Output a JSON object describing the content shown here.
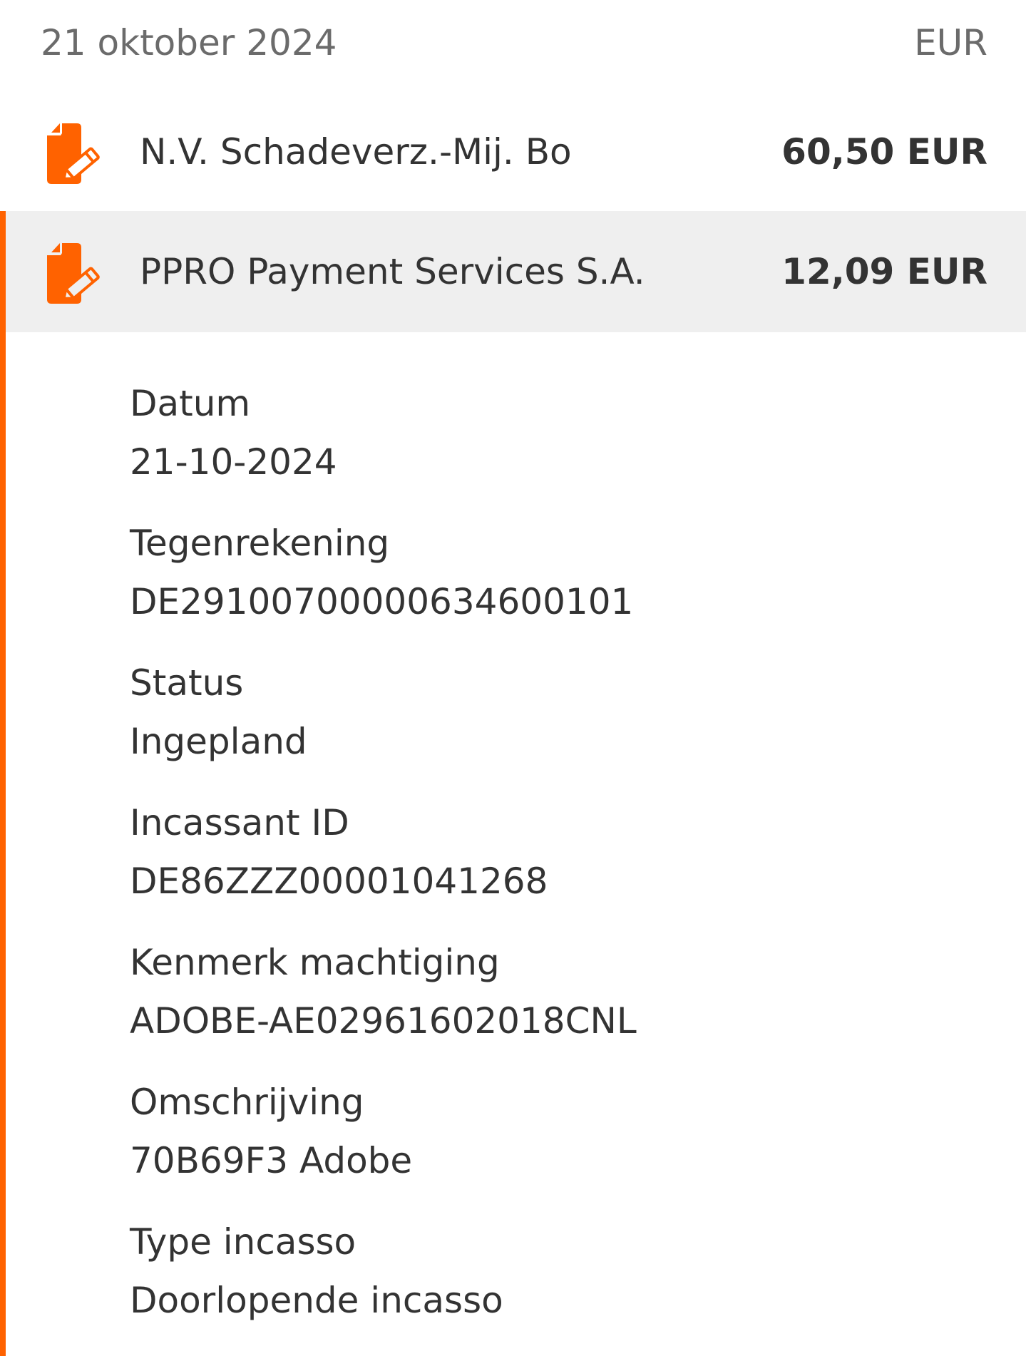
{
  "header": {
    "date": "21 oktober 2024",
    "currency": "EUR"
  },
  "colors": {
    "accent": "#ff6200",
    "selected_row_bg": "#efefef",
    "text": "#333333",
    "muted_text": "#6b6b6b"
  },
  "transactions": [
    {
      "icon": "direct-debit-icon",
      "name": "N.V. Schadeverz.-Mij. Bo",
      "amount": "60,50 EUR"
    },
    {
      "icon": "direct-debit-icon",
      "name": "PPRO Payment Services S.A.",
      "amount": "12,09 EUR"
    }
  ],
  "details": [
    {
      "label": "Datum",
      "value": "21-10-2024"
    },
    {
      "label": "Tegenrekening",
      "value": "DE29100700000634600101"
    },
    {
      "label": "Status",
      "value": "Ingepland"
    },
    {
      "label": "Incassant ID",
      "value": "DE86ZZZ00001041268"
    },
    {
      "label": "Kenmerk machtiging",
      "value": "ADOBE-AE02961602018CNL"
    },
    {
      "label": "Omschrijving",
      "value": "70B69F3 Adobe"
    },
    {
      "label": "Type incasso",
      "value": "Doorlopende incasso"
    }
  ]
}
